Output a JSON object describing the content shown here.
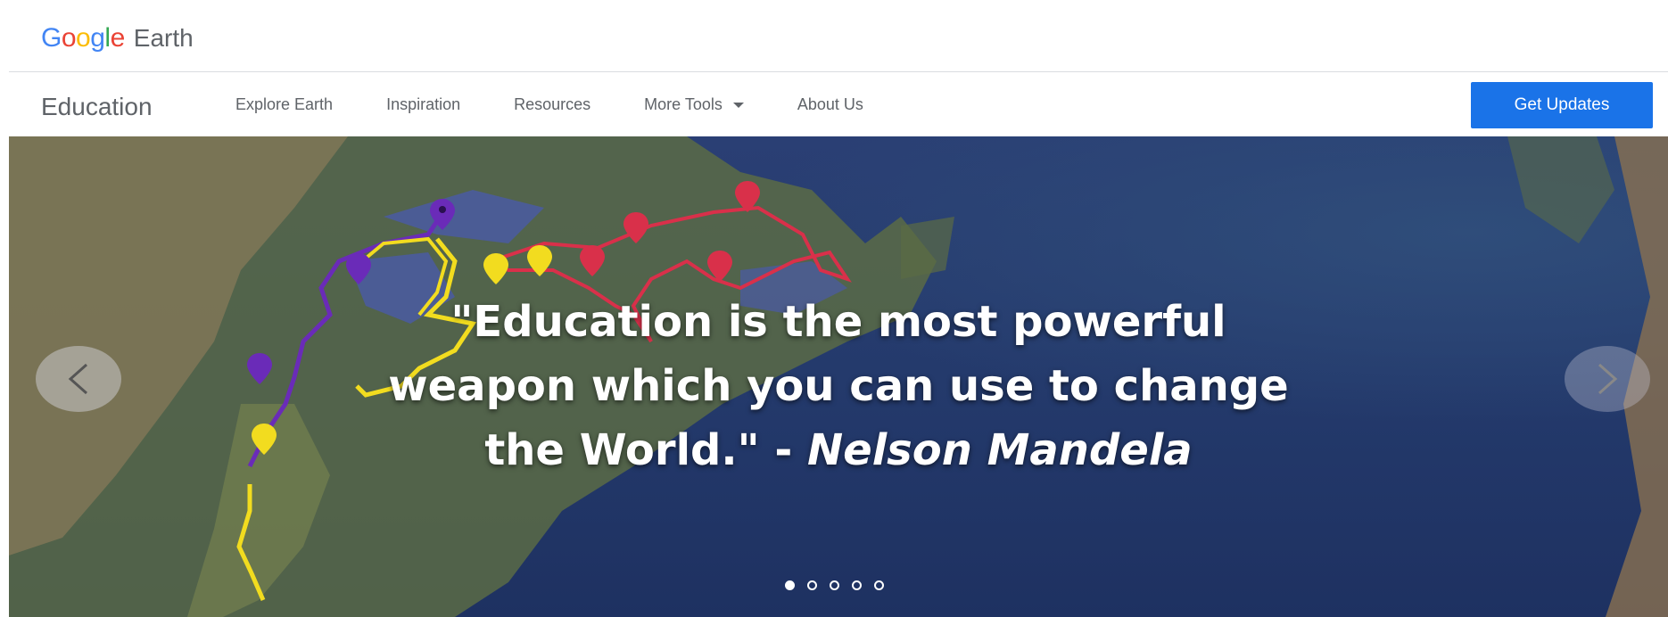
{
  "logo": {
    "google_letters": [
      {
        "char": "G",
        "color": "#4285F4"
      },
      {
        "char": "o",
        "color": "#EA4335"
      },
      {
        "char": "o",
        "color": "#FBBC05"
      },
      {
        "char": "g",
        "color": "#4285F4"
      },
      {
        "char": "l",
        "color": "#34A853"
      },
      {
        "char": "e",
        "color": "#EA4335"
      }
    ],
    "product": "Earth"
  },
  "nav": {
    "brand": "Education",
    "items": [
      {
        "label": "Explore Earth"
      },
      {
        "label": "Inspiration"
      },
      {
        "label": "Resources"
      },
      {
        "label": "More Tools",
        "icon": "caret-down-icon"
      },
      {
        "label": "About Us"
      }
    ],
    "cta": "Get Updates"
  },
  "hero": {
    "quote_line1": "\"Education is the most powerful",
    "quote_line2": "weapon which you can use to change",
    "quote_line3_text": "the World.\" - ",
    "quote_author": "Nelson Mandela",
    "prev_icon": "chevron-left-icon",
    "next_icon": "chevron-right-icon",
    "slides_count": 5,
    "active_slide": 1,
    "route_colors": {
      "purple": "#6a2bb8",
      "yellow": "#f2dc1f",
      "red": "#d9304a"
    }
  }
}
